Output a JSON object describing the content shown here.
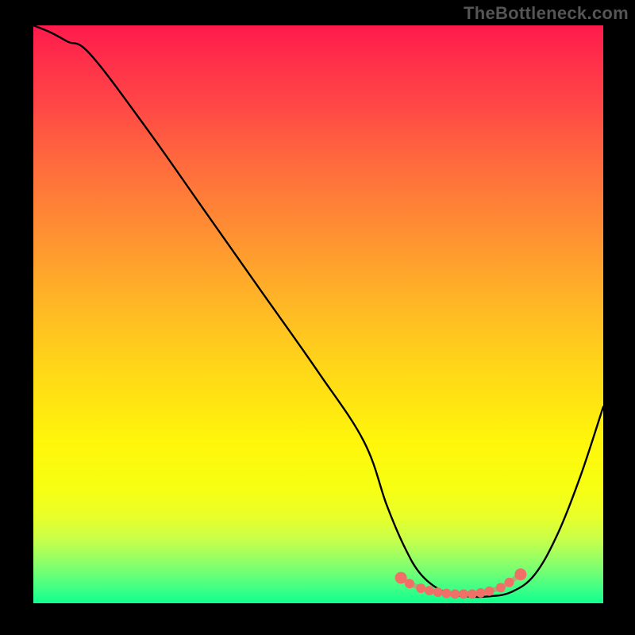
{
  "watermark": "TheBottleneck.com",
  "chart_data": {
    "type": "line",
    "title": "",
    "xlabel": "",
    "ylabel": "",
    "xlim": [
      0,
      100
    ],
    "ylim": [
      0,
      100
    ],
    "series": [
      {
        "name": "curve",
        "x": [
          0,
          3,
          6,
          10,
          20,
          30,
          40,
          50,
          58,
          62,
          65,
          68,
          72,
          76,
          80,
          84,
          88,
          92,
          96,
          100
        ],
        "y": [
          100,
          98.8,
          97.2,
          95,
          82,
          68,
          54,
          40,
          28,
          17,
          10,
          5,
          2,
          1.2,
          1.2,
          2,
          5,
          12,
          22,
          34
        ]
      }
    ],
    "markers": {
      "name": "accent-points",
      "x": [
        64.5,
        66,
        68,
        69.5,
        71,
        72.5,
        74,
        75.5,
        77,
        78.5,
        80,
        82,
        83.5,
        85.5
      ],
      "y": [
        4.4,
        3.4,
        2.6,
        2.2,
        1.9,
        1.7,
        1.6,
        1.6,
        1.6,
        1.8,
        2.1,
        2.7,
        3.6,
        5.0
      ]
    },
    "gradient_stops": [
      {
        "pos": 0.0,
        "color": "#ff1a4d"
      },
      {
        "pos": 0.14,
        "color": "#ff4846"
      },
      {
        "pos": 0.34,
        "color": "#ff8a34"
      },
      {
        "pos": 0.58,
        "color": "#ffd31a"
      },
      {
        "pos": 0.8,
        "color": "#f7ff12"
      },
      {
        "pos": 0.92,
        "color": "#9bff62"
      },
      {
        "pos": 1.0,
        "color": "#10ff8e"
      }
    ]
  }
}
